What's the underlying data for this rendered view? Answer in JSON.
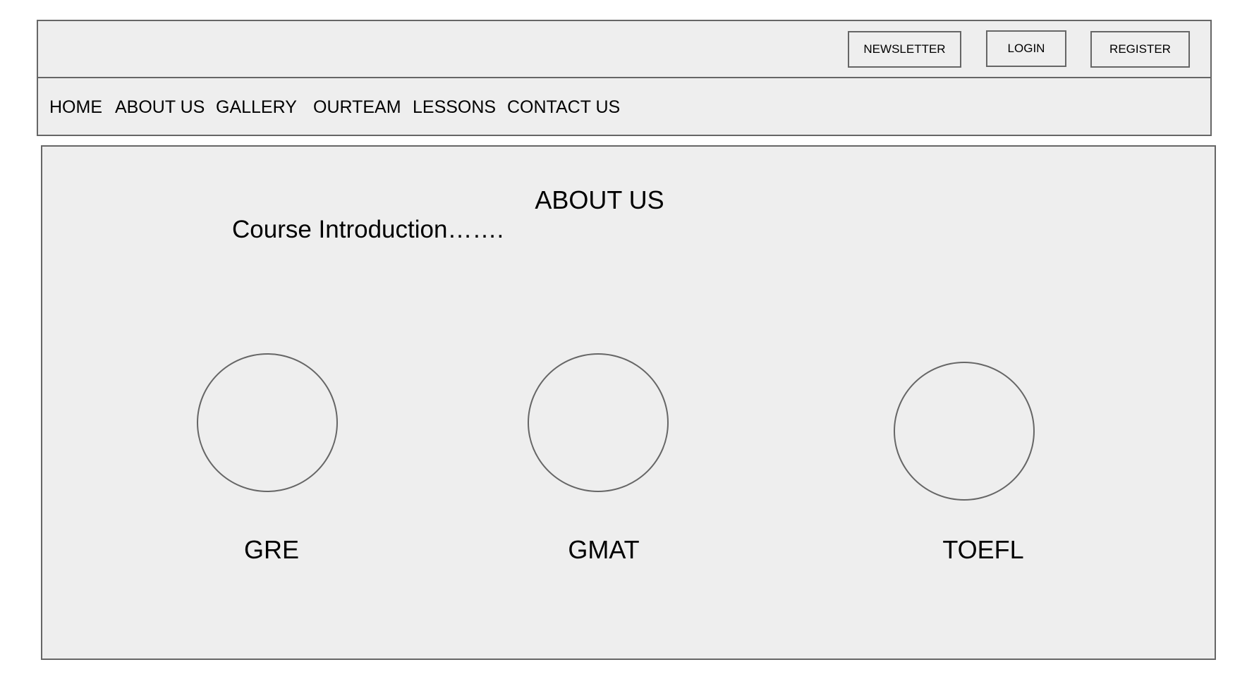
{
  "header": {
    "buttons": {
      "newsletter": "NEWSLETTER",
      "login": "LOGIN",
      "register": "REGISTER"
    }
  },
  "nav": {
    "items": [
      {
        "label": "HOME"
      },
      {
        "label": "ABOUT US"
      },
      {
        "label": "GALLERY"
      },
      {
        "label": "OURTEAM"
      },
      {
        "label": "LESSONS"
      },
      {
        "label": "CONTACT US"
      }
    ]
  },
  "main": {
    "title": "ABOUT US",
    "intro": "Course Introduction…….",
    "courses": [
      {
        "label": "GRE"
      },
      {
        "label": "GMAT"
      },
      {
        "label": "TOEFL"
      }
    ]
  },
  "colors": {
    "panel_bg": "#eeeeee",
    "border": "#666666",
    "text": "#000000"
  }
}
